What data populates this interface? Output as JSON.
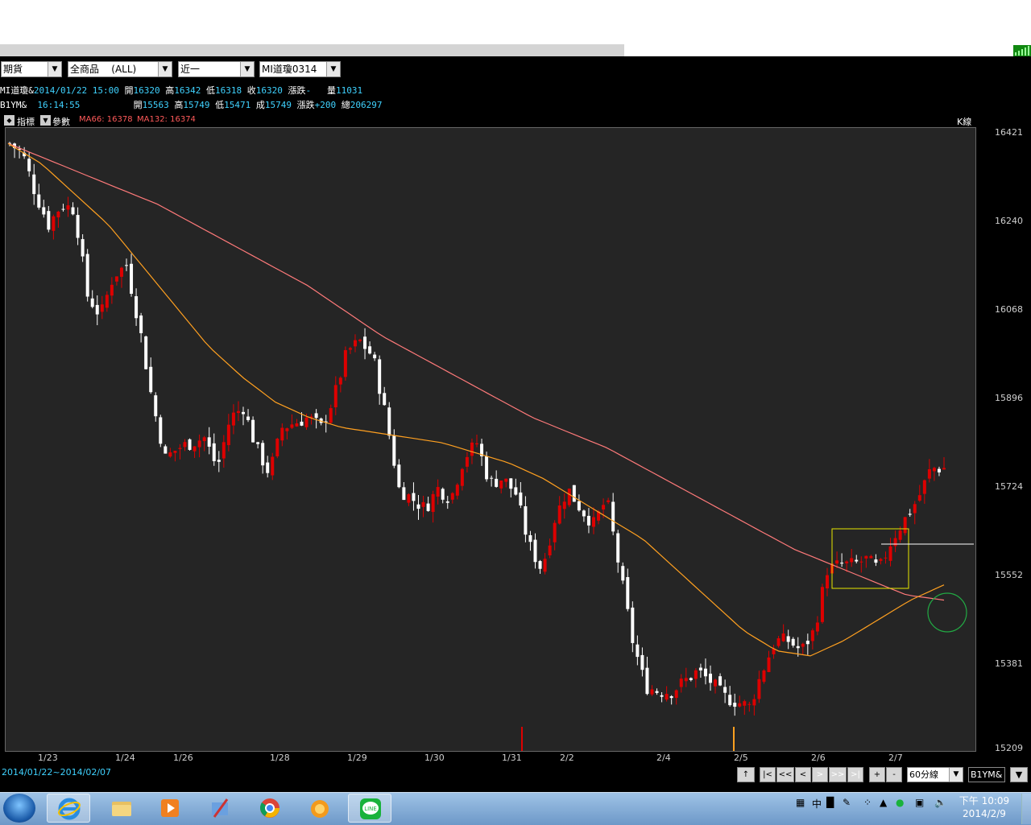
{
  "toolbar": {
    "market": "期貨",
    "product": "全商品    (ALL)",
    "period": "近一",
    "symbol": "MI道瓊0314"
  },
  "quote1": {
    "name": "MI道瓊&",
    "datetime": "2014/01/22 15:00",
    "open_label": "開",
    "open": "16320",
    "high_label": "高",
    "high": "16342",
    "low_label": "低",
    "low": "16318",
    "close_label": "收",
    "close": "16320",
    "change_label": "漲跌",
    "change": "-",
    "vol_label": "量",
    "vol": "11031"
  },
  "quote2": {
    "name": "B1YM&",
    "time": "16:14:55",
    "open_label": "開",
    "open": "15563",
    "high_label": "高",
    "high": "15749",
    "low_label": "低",
    "low": "15471",
    "last_label": "成",
    "last": "15749",
    "change_label": "漲跌",
    "change": "+200",
    "total_label": "總",
    "total": "206297"
  },
  "chartbar": {
    "indicator_label": "指標",
    "param_label": "參數",
    "ma66": "MA66: 16378",
    "ma132": "MA132: 16374",
    "chart_type": "K線"
  },
  "colors": {
    "up": "#dd0000",
    "down": "#ffffff",
    "ma66": "#ffa020",
    "ma132": "#ff7a7a",
    "bg": "#252525",
    "box": "#e6e600",
    "circle": "#22aa44"
  },
  "chart_data": {
    "type": "candlestick",
    "yticks": [
      "16421",
      "16240",
      "16068",
      "15896",
      "15724",
      "15552",
      "15381",
      "15209"
    ],
    "xticks": [
      "1/23",
      "1/24",
      "1/26",
      "1/28",
      "1/29",
      "1/30",
      "1/31",
      "2/2",
      "2/4",
      "2/5",
      "2/6",
      "2/7"
    ],
    "ylim": [
      15209,
      16421
    ],
    "close_path": [
      16400,
      16380,
      16300,
      16240,
      16280,
      16270,
      16100,
      16060,
      16140,
      16160,
      16040,
      15890,
      15780,
      15800,
      15810,
      15820,
      15760,
      15860,
      15880,
      15800,
      15750,
      15840,
      15850,
      15860,
      15840,
      15900,
      15990,
      16010,
      15980,
      15860,
      15720,
      15700,
      15680,
      15720,
      15700,
      15780,
      15810,
      15730,
      15740,
      15710,
      15610,
      15560,
      15660,
      15720,
      15680,
      15650,
      15700,
      15560,
      15420,
      15330,
      15320,
      15320,
      15340,
      15360,
      15340,
      15310,
      15300,
      15290,
      15360,
      15420,
      15420,
      15400,
      15440,
      15560,
      15570,
      15570,
      15580,
      15560,
      15620,
      15660,
      15700,
      15760,
      15760
    ],
    "ma66_path": [
      16400,
      16360,
      16300,
      16240,
      16160,
      16080,
      16000,
      15940,
      15890,
      15860,
      15840,
      15830,
      15820,
      15810,
      15790,
      15770,
      15740,
      15700,
      15660,
      15620,
      15560,
      15500,
      15440,
      15400,
      15390,
      15420,
      15460,
      15500,
      15530
    ],
    "ma132_path": [
      16400,
      16370,
      16340,
      16310,
      16280,
      16240,
      16200,
      16160,
      16120,
      16070,
      16020,
      15980,
      15940,
      15900,
      15860,
      15830,
      15800,
      15760,
      15720,
      15680,
      15640,
      15600,
      15570,
      15540,
      15510,
      15500
    ],
    "range": "2014/01/22~2014/02/07",
    "interval": "60分線",
    "symbol": "B1YM&"
  },
  "nav": {
    "up": "↑",
    "first": "|<",
    "prev_page": "<<",
    "prev": "<",
    "next": ">",
    "next_page": ">>",
    "last": ">|",
    "zoom_in": "+",
    "zoom_out": "-"
  },
  "taskbar": {
    "ime": "中",
    "clock_time": "下午 10:09",
    "clock_date": "2014/2/9"
  }
}
